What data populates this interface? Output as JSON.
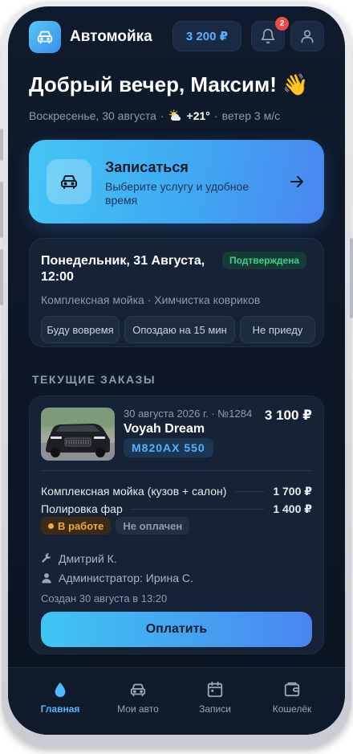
{
  "header": {
    "title": "Автомойка",
    "balance": "3 200 ₽",
    "notification_count": "2"
  },
  "greeting": {
    "text": "Добрый вечер, Максим! 👋",
    "date": "Воскресенье, 30 августа",
    "separator1": "·",
    "temperature": "+21°",
    "separator2": "·",
    "wind": "ветер 3 м/с"
  },
  "booking": {
    "title": "Записаться",
    "subtitle": "Выберите услугу и удобное время"
  },
  "appointment": {
    "datetime": "Понедельник, 31 Августа, 12:00",
    "status": "Подтверждена",
    "services": "Комплексная мойка · Химчистка ковриков",
    "actions": [
      "Буду вовремя",
      "Опоздаю на 15 мин",
      "Не приеду"
    ]
  },
  "orders": {
    "section_title": "ТЕКУЩИЕ ЗАКАЗЫ",
    "items": [
      {
        "meta": "30 августа 2026 г. · №1284",
        "price": "3 100 ₽",
        "car": "Voyah Dream",
        "plate": "М820АХ 550",
        "lines": [
          {
            "name": "Комплексная мойка (кузов + салон)",
            "amount": "1 700 ₽"
          },
          {
            "name": "Полировка фар",
            "amount": "1 400 ₽"
          }
        ],
        "status_work": "В работе",
        "status_payment": "Не оплачен",
        "master": "Дмитрий К.",
        "admin": "Администратор: Ирина С.",
        "created": "Создан 30 августа в 13:20",
        "pay_label": "Оплатить"
      }
    ]
  },
  "nav": {
    "items": [
      {
        "label": "Главная",
        "icon": "drop-icon"
      },
      {
        "label": "Мои авто",
        "icon": "car-icon"
      },
      {
        "label": "Записи",
        "icon": "calendar-icon"
      },
      {
        "label": "Кошелёк",
        "icon": "wallet-icon"
      }
    ]
  },
  "colors": {
    "accent": "#4fb8ff",
    "background": "#0f1a2c",
    "card": "#162336",
    "success": "#3ecf8e",
    "warning": "#f3a83b",
    "danger": "#ef4a4a"
  }
}
